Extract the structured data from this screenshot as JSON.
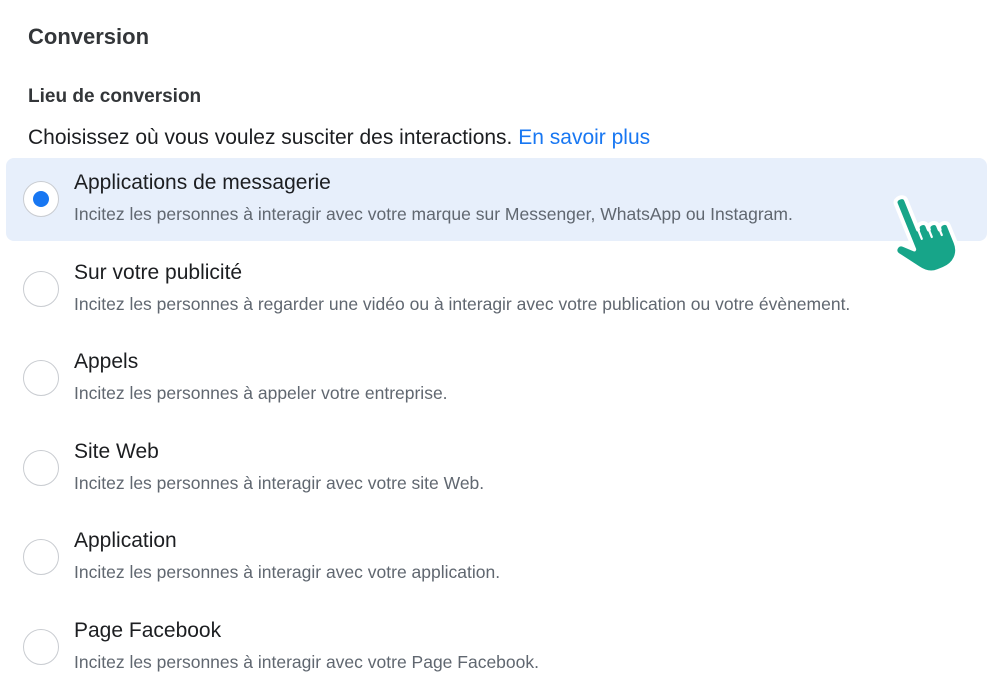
{
  "section": {
    "title": "Conversion"
  },
  "conversion_location": {
    "title": "Lieu de conversion",
    "helper_text": "Choisissez où vous voulez susciter des interactions.",
    "learn_more": "En savoir plus"
  },
  "options": [
    {
      "title": "Applications de messagerie",
      "description": "Incitez les personnes à interagir avec votre marque sur Messenger, WhatsApp ou Instagram.",
      "selected": true
    },
    {
      "title": "Sur votre publicité",
      "description": "Incitez les personnes à regarder une vidéo ou à interagir avec votre publication ou votre évènement.",
      "selected": false
    },
    {
      "title": "Appels",
      "description": "Incitez les personnes à appeler votre entreprise.",
      "selected": false
    },
    {
      "title": "Site Web",
      "description": "Incitez les personnes à interagir avec votre site Web.",
      "selected": false
    },
    {
      "title": "Application",
      "description": "Incitez les personnes à interagir avec votre application.",
      "selected": false
    },
    {
      "title": "Page Facebook",
      "description": "Incitez les personnes à interagir avec votre Page Facebook.",
      "selected": false
    }
  ],
  "cursor": {
    "icon": "hand-pointer-icon",
    "color": "#17a589"
  },
  "colors": {
    "accent": "#1877f2",
    "selected_background": "#e7effb",
    "secondary_text": "#606770"
  }
}
